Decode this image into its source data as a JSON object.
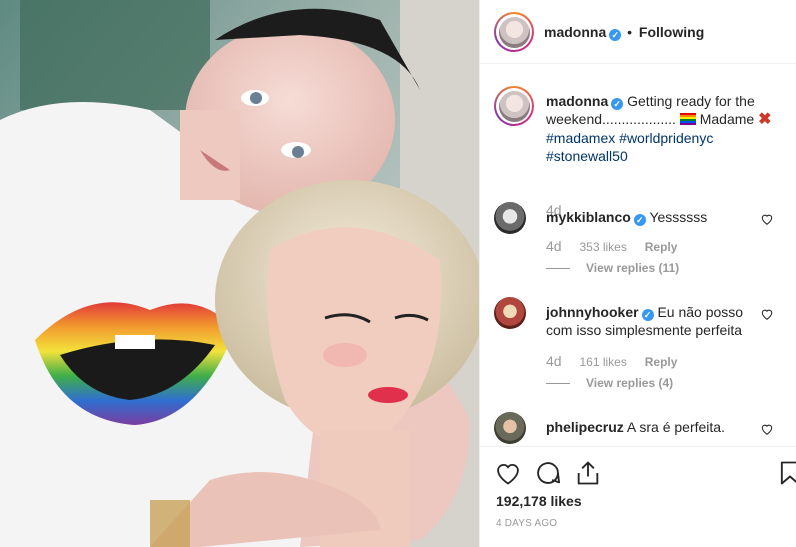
{
  "post": {
    "author": "madonna",
    "follow_status": "Following",
    "separator": "•",
    "verified_mark": "✓",
    "caption_text": "Getting ready for the weekend................... ",
    "caption_word": "Madame",
    "caption_emoji_cross": "✖",
    "hashtags": [
      "#madamex",
      "#worldpridenyc",
      "#stonewall50"
    ],
    "caption_age": "4d",
    "likes": "192,178 likes",
    "time_ago": "4 DAYS AGO"
  },
  "comments": [
    {
      "user": "mykkiblanco",
      "verified": true,
      "text": "Yessssss",
      "age": "4d",
      "likes": "353 likes",
      "reply": "Reply",
      "view_replies": "View replies (11)"
    },
    {
      "user": "johnnyhooker",
      "verified": true,
      "text": "Eu não posso com isso simplesmente perfeita",
      "age": "4d",
      "likes": "161 likes",
      "reply": "Reply",
      "view_replies": "View replies (4)"
    },
    {
      "user": "phelipecruz",
      "verified": false,
      "text": "A sra é perfeita."
    }
  ],
  "icons": {
    "like": "heart-icon",
    "comment": "comment-icon",
    "share": "share-icon",
    "save": "bookmark-icon"
  },
  "colors": {
    "link": "#003569",
    "verified": "#3897f0",
    "muted": "#999999"
  }
}
